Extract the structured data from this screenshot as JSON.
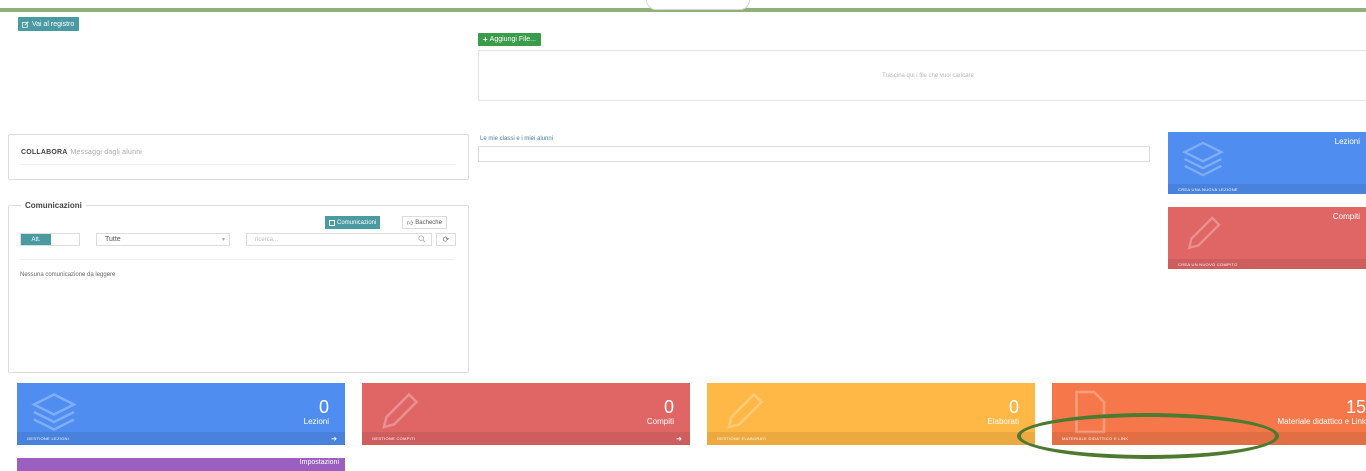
{
  "header": {
    "registro_button": "Vai al registro",
    "aggiungi_button": "Aggiungi File...",
    "dropzone_text": "Trascina qui i file che vuoi caricare"
  },
  "collabora": {
    "title": "COLLABORA",
    "subtitle": "Messaggi dagli alunni"
  },
  "comunicazioni": {
    "title": "Comunicazioni",
    "btn_comunicazioni": "Comunicazioni",
    "btn_bacheche": "Bacheche",
    "toggle_label": "Att.",
    "filter_value": "Tutte",
    "search_placeholder": "ricerca...",
    "empty_text": "Nessuna comunicazione da leggere"
  },
  "classi": {
    "label": "Le mie classi e i miei alunni"
  },
  "side_cards": [
    {
      "title": "Lezioni",
      "footer": "CREA UNA NUOVA LEZIONE",
      "color": "#4f8ef0"
    },
    {
      "title": "Compiti",
      "footer": "CREA UN NUOVO COMPITO",
      "color": "#e06666"
    }
  ],
  "stat_cards": [
    {
      "count": "0",
      "label": "Lezioni",
      "footer": "GESTIONE LEZIONI",
      "color": "#4f8ef0"
    },
    {
      "count": "0",
      "label": "Compiti",
      "footer": "GESTIONE COMPITI",
      "color": "#e06666"
    },
    {
      "count": "0",
      "label": "Elaborati",
      "footer": "GESTIONE ELABORATI",
      "color": "#ffb845"
    },
    {
      "count": "15",
      "label": "Materiale didattico e Link",
      "footer": "MATERIALE DIDATTICO E LINK",
      "color": "#f6784a"
    }
  ],
  "impostazioni_card": {
    "label": "Impostazioni",
    "color": "#9b5fc0"
  },
  "icons": {
    "registro": "pencil-square-icon",
    "aggiungi": "plus-icon",
    "comunicazioni": "square-icon",
    "bacheche": "thumbs-up-icon",
    "search": "magnifier-icon",
    "refresh": "refresh-icon",
    "arrow": "circle-arrow-right-icon",
    "layers": "layers-icon",
    "pencil": "pencil-icon"
  },
  "annotation": {
    "color": "#4d7a30",
    "shape": "ellipse"
  }
}
